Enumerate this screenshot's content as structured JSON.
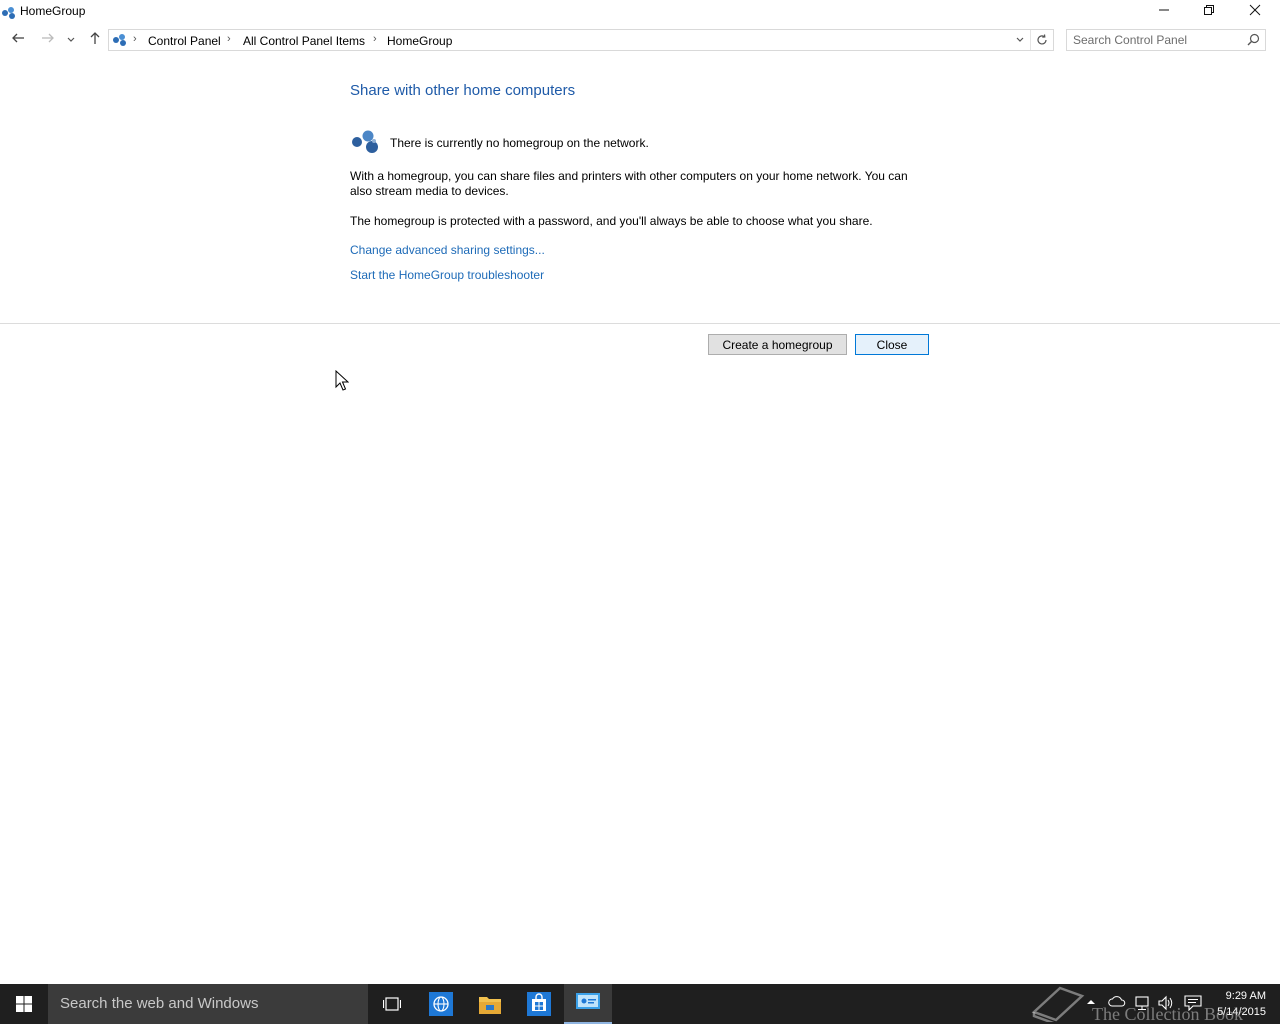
{
  "window": {
    "title": "HomeGroup",
    "minimize_label": "Minimize",
    "restore_label": "Restore",
    "close_label": "Close"
  },
  "address_bar": {
    "breadcrumbs": [
      "Control Panel",
      "All Control Panel Items",
      "HomeGroup"
    ],
    "search_placeholder": "Search Control Panel"
  },
  "main": {
    "heading": "Share with other home computers",
    "status": "There is currently no homegroup on the network.",
    "paragraph1": "With a homegroup, you can share files and printers with other computers on your home network. You can also stream media to devices.",
    "paragraph2": "The homegroup is protected with a password, and you'll always be able to choose what you share.",
    "links": [
      "Change advanced sharing settings...",
      "Start the HomeGroup troubleshooter"
    ],
    "buttons": {
      "create": "Create a homegroup",
      "close": "Close"
    }
  },
  "taskbar": {
    "search_placeholder": "Search the web and Windows",
    "watermark": "The Collection Book",
    "time": "9:29 AM",
    "date": "5/14/2015"
  },
  "colors": {
    "heading": "#1e5aa8",
    "link": "#1e6bb8",
    "taskbar": "#1f1f1f"
  }
}
